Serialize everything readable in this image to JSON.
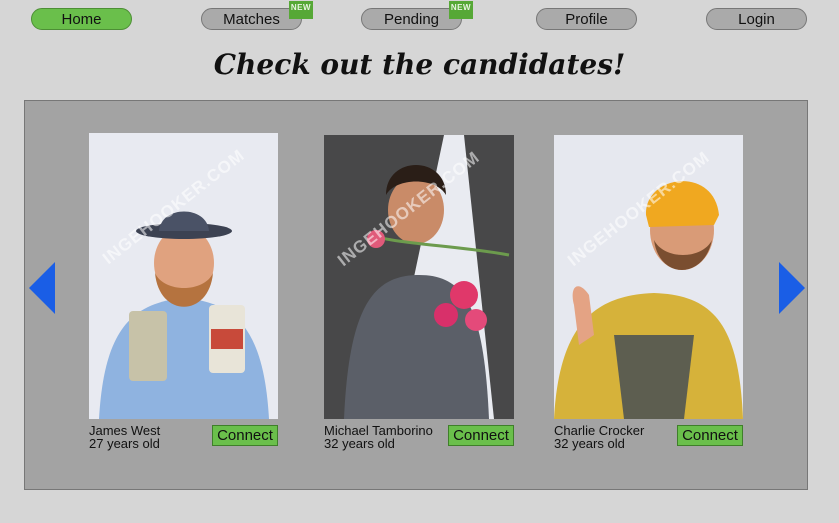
{
  "nav": {
    "home": "Home",
    "matches": "Matches",
    "pending": "Pending",
    "profile": "Profile",
    "login": "Login",
    "new_badge": "NEW"
  },
  "page_title": "Check out the candidates!",
  "watermark": "INGEHOOKER.COM",
  "candidates": [
    {
      "name": "James West",
      "age": "27 years old",
      "connect_label": "Connect"
    },
    {
      "name": "Michael Tamborino",
      "age": "32 years old",
      "connect_label": "Connect"
    },
    {
      "name": "Charlie Crocker",
      "age": "32 years old",
      "connect_label": "Connect"
    }
  ],
  "icons": {
    "prev": "left-arrow-icon",
    "next": "right-arrow-icon"
  },
  "colors": {
    "accent": "#6abf4b",
    "nav_inactive": "#aaaaaa",
    "arrow": "#1a5ee6",
    "panel": "#a3a3a3",
    "page_bg": "#d6d6d6"
  }
}
